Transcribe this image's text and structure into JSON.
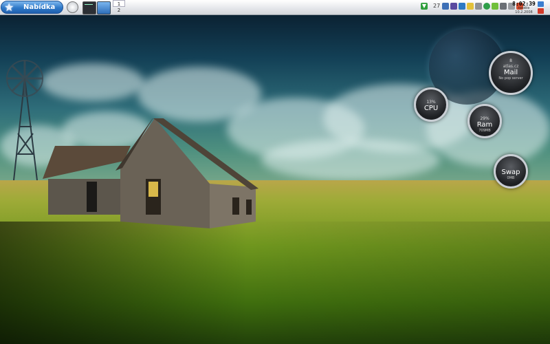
{
  "taskbar": {
    "menu_label": "Nabídka",
    "pager": [
      "1",
      "2"
    ],
    "tray_count": "27",
    "clock_time": "8:02:39",
    "clock_day": "neděle",
    "clock_date": "10.2.2008"
  },
  "gadgets": {
    "mail": {
      "top": "8",
      "host": "atlas.cz",
      "name": "Mail",
      "status": "No pop server"
    },
    "cpu": {
      "percent": "13%",
      "name": "CPU"
    },
    "ram": {
      "percent": "29%",
      "name": "Ram",
      "detail": "709MB"
    },
    "swap": {
      "name": "Swap",
      "detail": "0MB"
    }
  },
  "icons": {
    "menu": "star-icon",
    "launchers": [
      "clock-app-icon",
      "terminal-icon",
      "show-desktop-icon"
    ],
    "tray": [
      "download-arrow-icon",
      "network-icon",
      "app-icon",
      "sync-icon",
      "note-icon",
      "gear-icon",
      "update-icon",
      "refresh-icon",
      "volume-icon",
      "battery-icon",
      "flag-icon"
    ]
  },
  "colors": {
    "menu_button": "#2f79c9",
    "gadget_ring": "#c9ced4"
  }
}
